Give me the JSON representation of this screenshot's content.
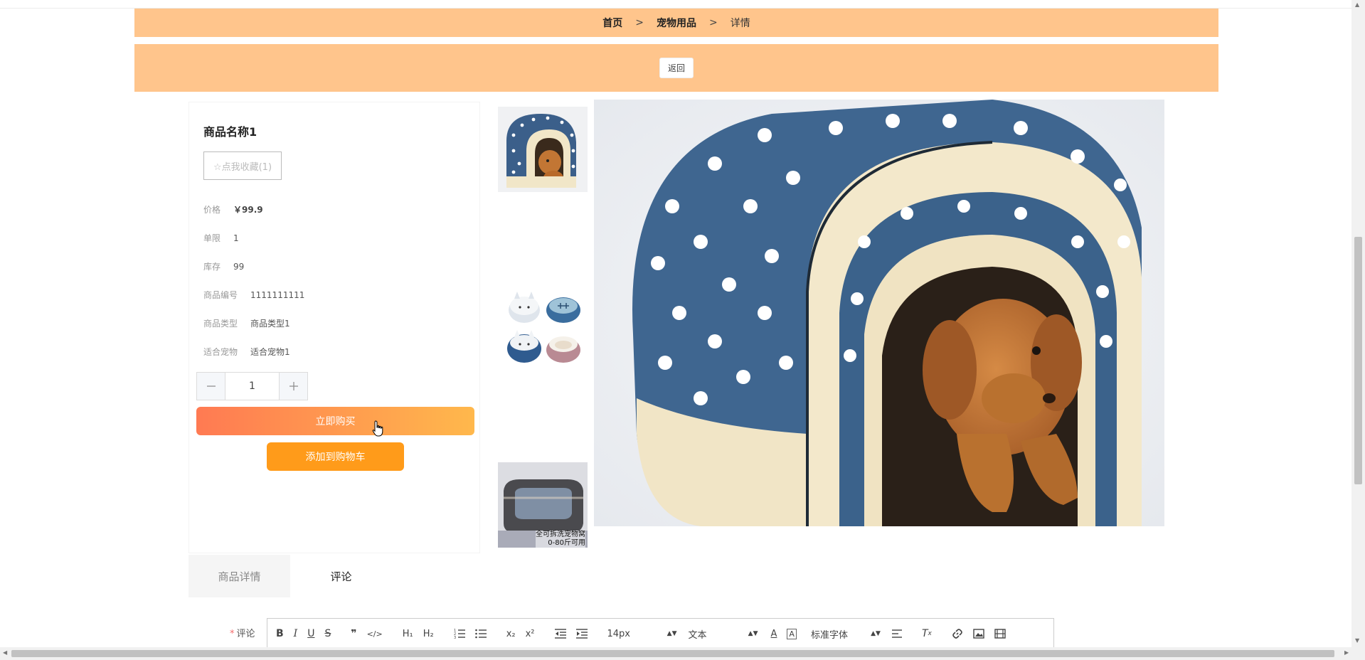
{
  "breadcrumb": {
    "home": "首页",
    "separator": ">",
    "category": "宠物用品",
    "current": "详情"
  },
  "return_button": "返回",
  "product": {
    "name": "商品名称1",
    "favorite_label": "☆点我收藏(1)",
    "fields": {
      "price_label": "价格",
      "price_value": "￥99.9",
      "limit_label": "单限",
      "limit_value": "1",
      "stock_label": "库存",
      "stock_value": "99",
      "code_label": "商品编号",
      "code_value": "1111111111",
      "type_label": "商品类型",
      "type_value": "商品类型1",
      "pet_label": "适合宠物",
      "pet_value": "适合宠物1"
    },
    "quantity": "1",
    "buy_now": "立即购买",
    "add_to_cart": "添加到购物车"
  },
  "thumbnails": {
    "caption_line1": "全可拆洗宠物窝",
    "caption_line2": "0-80斤可用"
  },
  "tabs": {
    "details": "商品详情",
    "comments": "评论"
  },
  "comment": {
    "required_mark": "*",
    "label": "评论",
    "toolbar": {
      "font_size": "14px",
      "block_type": "文本",
      "font_family": "标准字体"
    }
  },
  "colors": {
    "bar_bg": "#ffc58c",
    "buy_gradient_start": "#ff7a52",
    "buy_gradient_end": "#ffb84c",
    "cart_bg": "#ff9b1a"
  }
}
